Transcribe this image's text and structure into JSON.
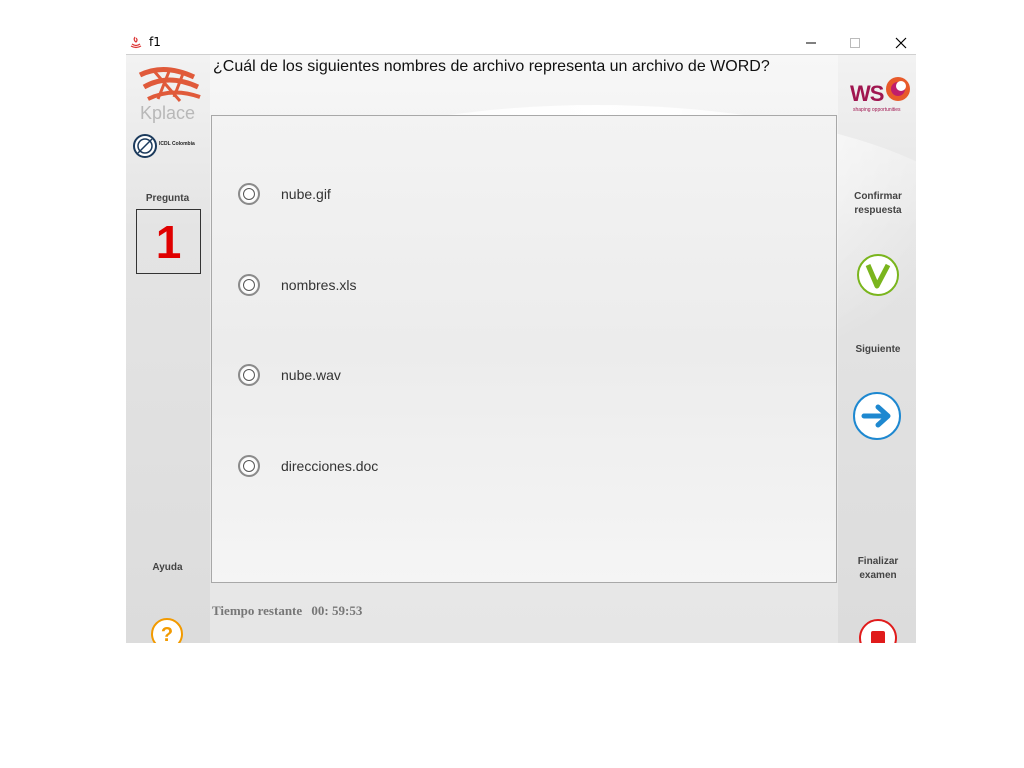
{
  "window": {
    "title": "f1"
  },
  "question": {
    "text": "¿Cuál de los siguientes nombres de archivo representa un archivo de WORD?"
  },
  "logos": {
    "kplace": "Kplace",
    "icdl": "ICDL Colombia",
    "ws": "WS",
    "ws_tagline": "shaping opportunities"
  },
  "sidebar": {
    "pregunta_label": "Pregunta",
    "question_number": "1",
    "ayuda_label": "Ayuda"
  },
  "options": [
    {
      "label": "nube.gif"
    },
    {
      "label": "nombres.xls"
    },
    {
      "label": "nube.wav"
    },
    {
      "label": "direcciones.doc"
    }
  ],
  "actions": {
    "confirm_label": "Confirmar respuesta",
    "next_label": "Siguiente",
    "finish_label": "Finalizar examen"
  },
  "timer": {
    "label": "Tiempo restante",
    "value": "00: 59:53"
  },
  "colors": {
    "question_number": "#e00000",
    "confirm": "#7ab51d",
    "next": "#1e88d0",
    "finish": "#e01b1b",
    "help": "#f29a00",
    "ws_brand": "#a01650"
  }
}
